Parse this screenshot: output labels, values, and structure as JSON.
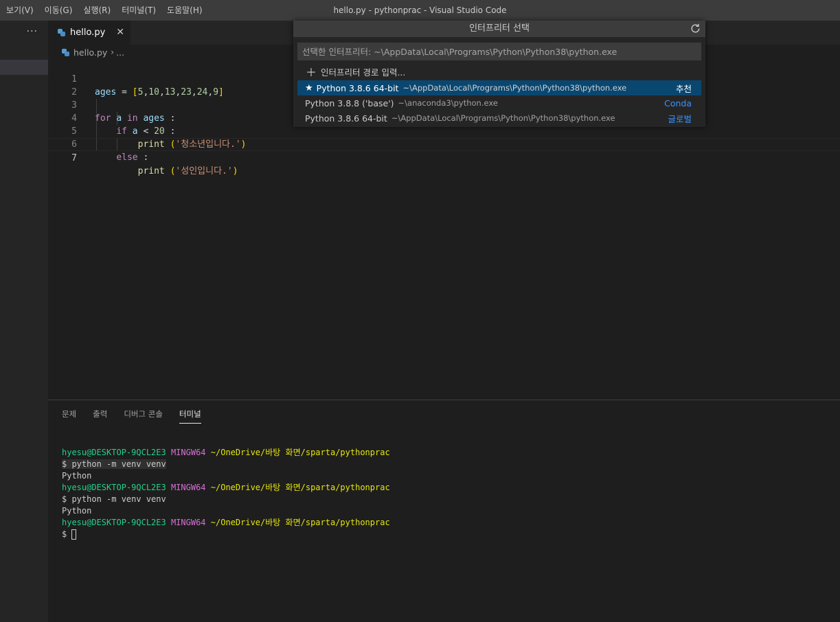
{
  "menu": [
    "보기(V)",
    "이동(G)",
    "실행(R)",
    "터미널(T)",
    "도움말(H)"
  ],
  "window_title": "hello.py - pythonprac - Visual Studio Code",
  "sidebar": {
    "more": "···"
  },
  "tab": {
    "label": "hello.py",
    "close": "✕"
  },
  "breadcrumb": {
    "file": "hello.py",
    "sep": "›",
    "more": "..."
  },
  "editor": {
    "line_numbers": [
      "1",
      "2",
      "3",
      "4",
      "5",
      "6",
      "7"
    ],
    "l1": {
      "var": "ages",
      "eq": " = ",
      "ob": "[",
      "n1": "5",
      "n2": "10",
      "n3": "13",
      "n4": "23",
      "n5": "24",
      "n6": "9",
      "comma": ",",
      "cb": "]"
    },
    "l3": {
      "for": "for",
      "a": "a",
      "in": "in",
      "ages": "ages",
      "colon": " :"
    },
    "l4": {
      "if": "if",
      "a": "a",
      "lt": " < ",
      "num": "20",
      "colon": " :"
    },
    "l5": {
      "fn": "print",
      "op": "(",
      "str": "'청소년입니다.'",
      "cp": ")"
    },
    "l6": {
      "else": "else",
      "colon": " :"
    },
    "l7": {
      "fn": "print",
      "op": "(",
      "str": "'성인입니다.'",
      "cp": ")"
    }
  },
  "quick_pick": {
    "title": "인터프리터 선택",
    "input_placeholder": "선택한 인터프리터: ~\\AppData\\Local\\Programs\\Python\\Python38\\python.exe",
    "enter_path": "인터프리터 경로 입력...",
    "items": [
      {
        "label": "Python 3.8.6 64-bit",
        "path": "~\\AppData\\Local\\Programs\\Python\\Python38\\python.exe",
        "detail": "추천",
        "detail_color": "#ffffff",
        "star": "★"
      },
      {
        "label": "Python 3.8.8 ('base')",
        "path": "~\\anaconda3\\python.exe",
        "detail": "Conda",
        "detail_color": "#3794ff"
      },
      {
        "label": "Python 3.8.6 64-bit",
        "path": "~\\AppData\\Local\\Programs\\Python\\Python38\\python.exe",
        "detail": "글로벌",
        "detail_color": "#3794ff"
      }
    ]
  },
  "panel": {
    "tabs": [
      "문제",
      "출력",
      "디버그 콘솔",
      "터미널"
    ],
    "active_tab": "터미널"
  },
  "terminal": {
    "user": "hyesu@DESKTOP-9QCL2E3",
    "mingw": "MINGW64",
    "path": "~/OneDrive/바탕 화면/sparta/pythonprac",
    "command": "$ python -m venv venv",
    "output": "Python",
    "prompt": "$ "
  }
}
